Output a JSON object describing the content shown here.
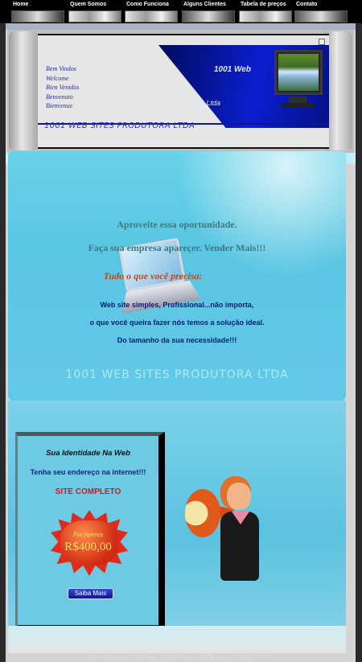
{
  "nav": {
    "items": [
      {
        "label": "Home"
      },
      {
        "label": "Quem Somos"
      },
      {
        "label": "Como Funciona"
      },
      {
        "label": "Alguns Clientes"
      },
      {
        "label": "Tabela de preços"
      },
      {
        "label": "Contato"
      }
    ]
  },
  "banner": {
    "welcome_lines": [
      "Bem Vindos",
      "Welcome",
      "Bien Venidos",
      "Benvenuto",
      "Bienvenue"
    ],
    "brand_a": "1001 Web",
    "brand_b": "ora Ltda",
    "company": "1001 WEB SITES PRODUTORA LTDA"
  },
  "main": {
    "line1": "Aproveite essa oportunidade.",
    "line2": "Faça sua empresa apareçer. Vender Mais!!!",
    "line3": "Tudo o que você precisa:",
    "line4": "Web site simples, Profissional...não importa,",
    "line5": "o que você queira fazer nós temos a solução ideal.",
    "line6": "Do tamanho da sua necessidade!!!",
    "watermark": "1001 WEB SITES PRODUTORA LTDA"
  },
  "promo": {
    "title": "Sua Identidade Na Web",
    "subtitle": "Tenha seu endereço na internet!!!",
    "headline": "SITE COMPLETO",
    "por_apenas": "Por Apenas",
    "price": "R$400,00",
    "button": "Saiba Mais"
  },
  "footer": {
    "text": "Rua Dr.Seng,100 Apto 12 São Paulo-SP Fone:(11)3263-1059"
  },
  "colors": {
    "nav_bg": "#000000",
    "banner_blue": "#0a1fd0",
    "cyan": "#5bc6e2",
    "price_red": "#e22a1a",
    "price_yellow": "#ffe25a"
  }
}
